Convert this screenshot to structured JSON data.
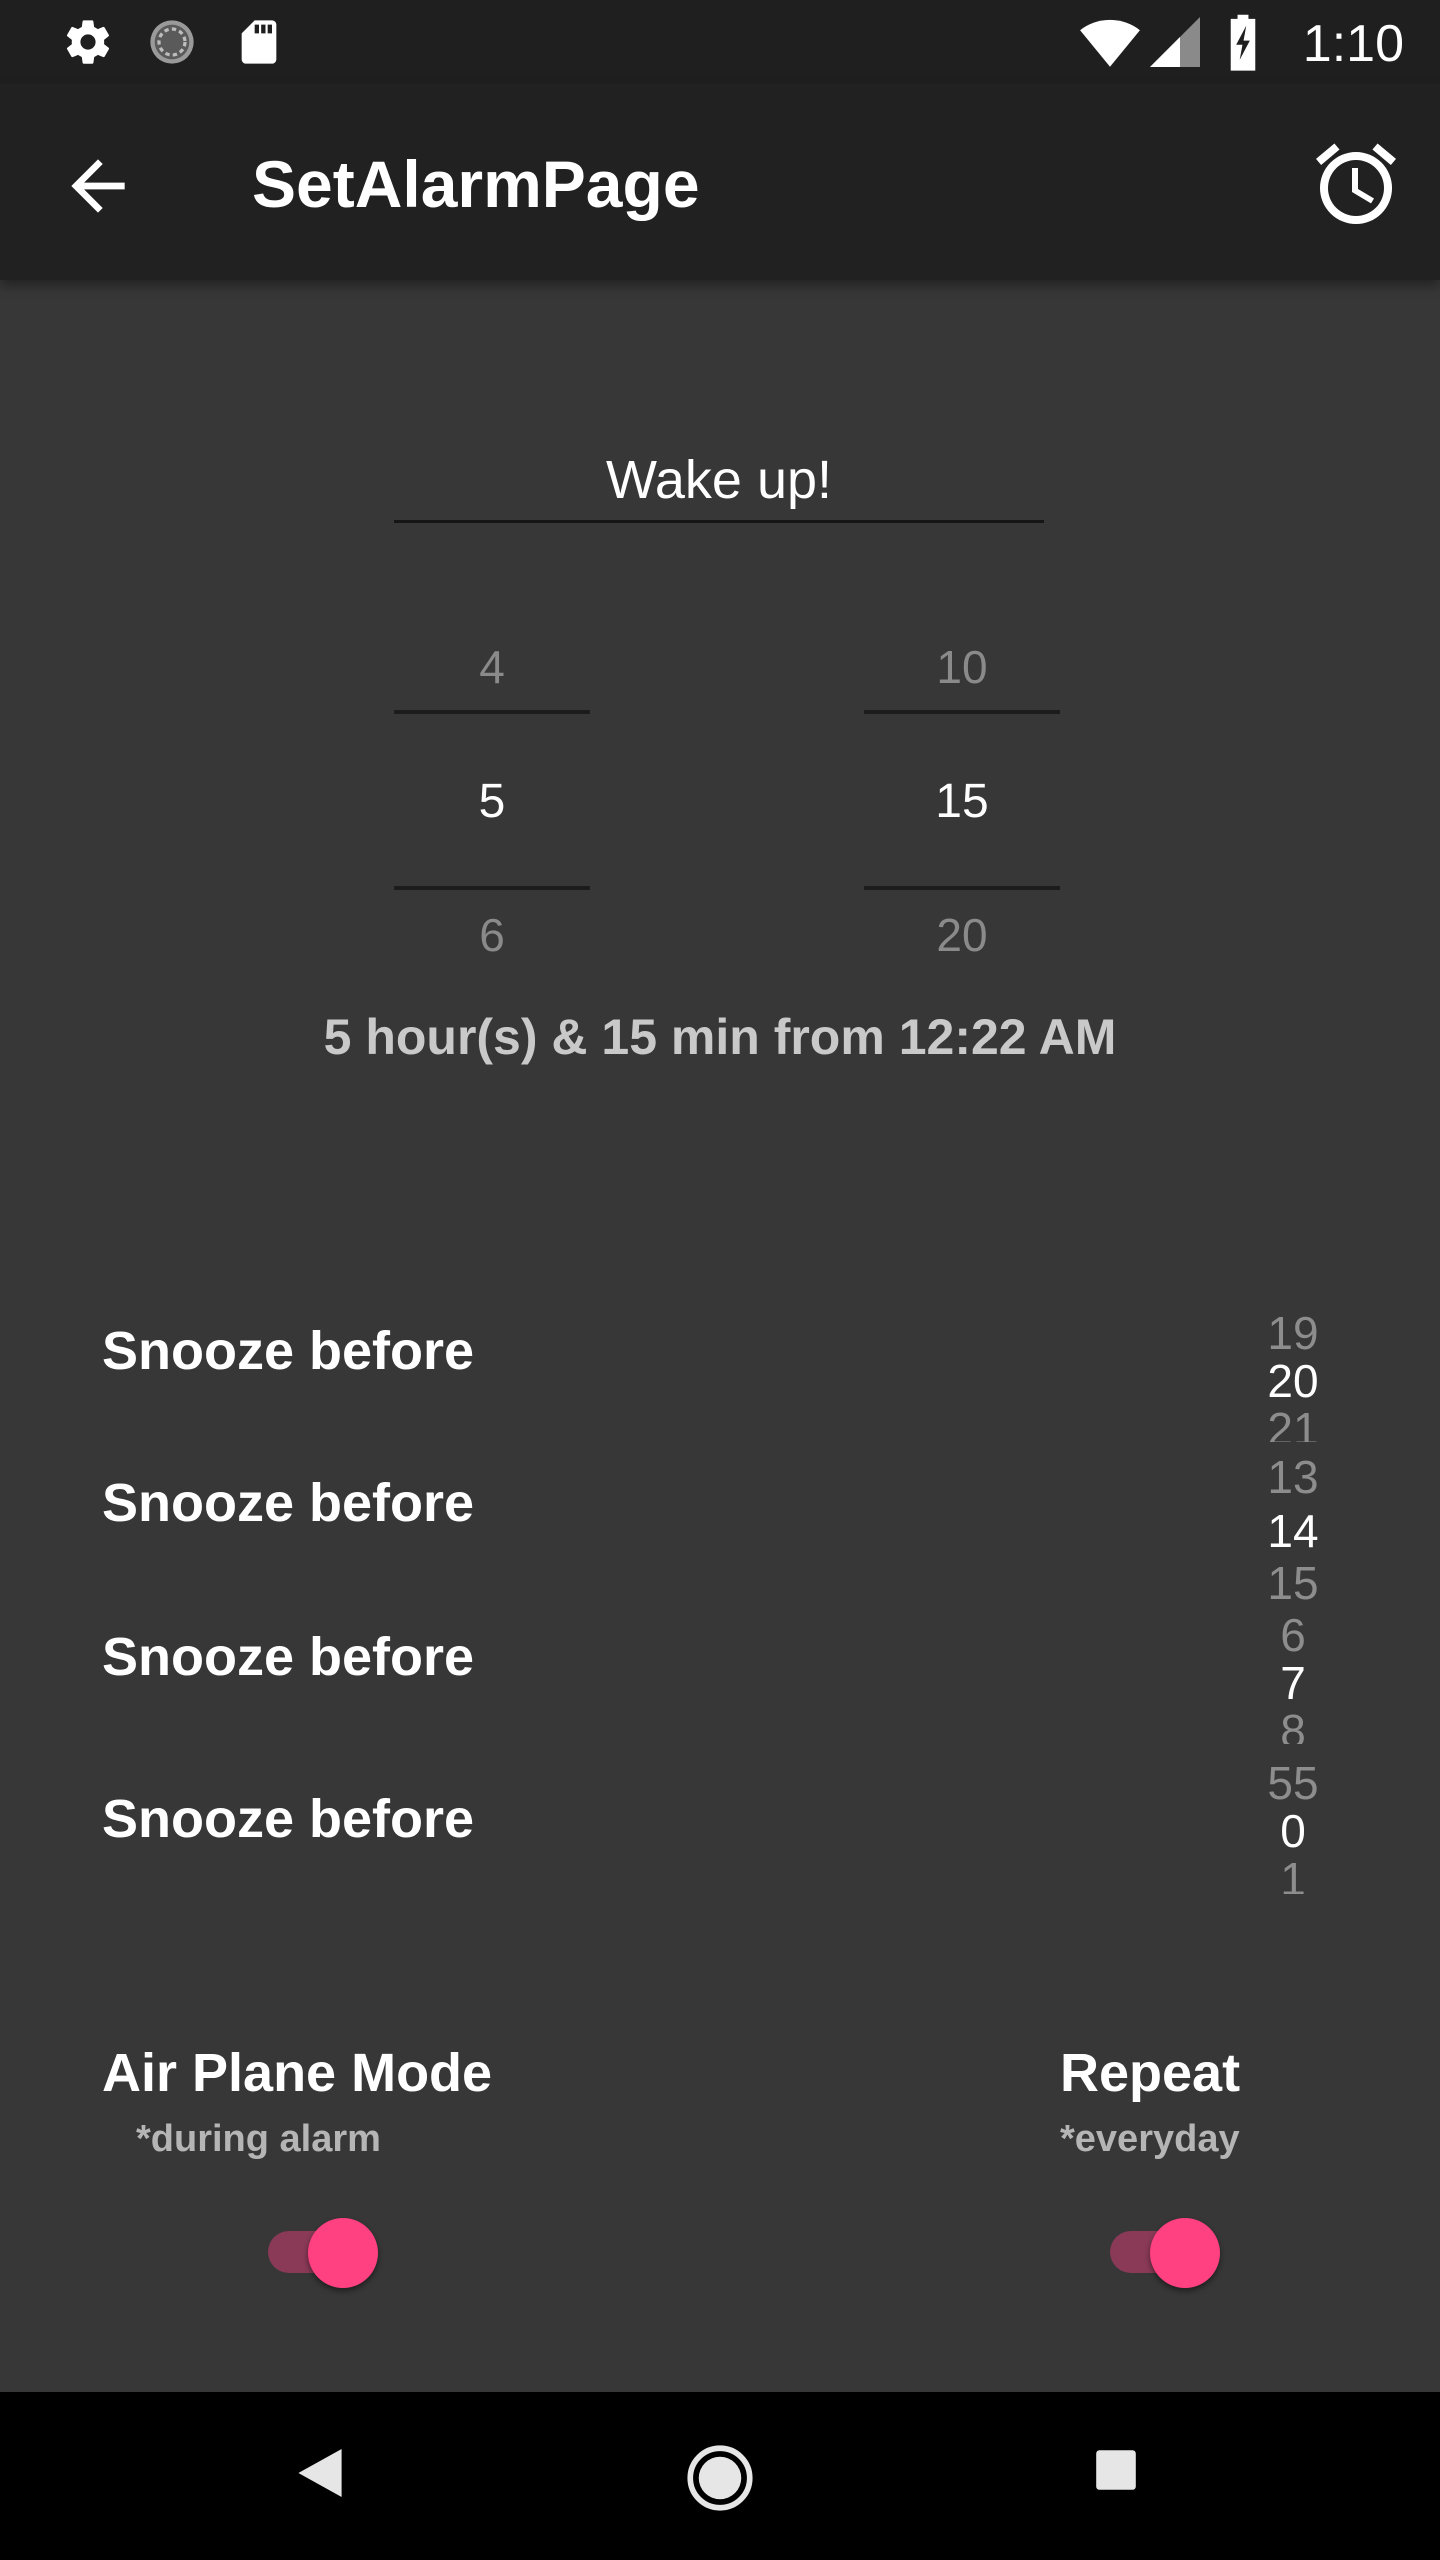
{
  "status_bar": {
    "time": "1:10",
    "left_icons": [
      "gear-icon",
      "loading-icon",
      "sd-card-icon"
    ],
    "right_icons": [
      "wifi-icon",
      "signal-icon",
      "battery-charging-icon"
    ]
  },
  "app_bar": {
    "title": "SetAlarmPage",
    "back_icon": "arrow-left-icon",
    "action_icon": "alarm-clock-icon"
  },
  "label_input": {
    "value": "Wake up!"
  },
  "hour_picker": {
    "prev": "4",
    "selected": "5",
    "next": "6"
  },
  "minute_picker": {
    "prev": "10",
    "selected": "15",
    "next": "20"
  },
  "duration_text": "5 hour(s) & 15 min from 12:22 AM",
  "snooze_rows": [
    {
      "label": "Snooze before",
      "prev": "19",
      "selected": "20",
      "next": "21"
    },
    {
      "label": "Snooze before",
      "prev": "13",
      "selected": "14",
      "next": "15"
    },
    {
      "label": "Snooze before",
      "prev": "6",
      "selected": "7",
      "next": "8"
    },
    {
      "label": "Snooze before",
      "prev": "55",
      "selected": "0",
      "next": "1"
    }
  ],
  "airplane": {
    "title": "Air Plane Mode",
    "subtitle": "*during alarm",
    "enabled": true
  },
  "repeat": {
    "title": "Repeat",
    "subtitle": "*everyday",
    "enabled": true
  },
  "colors": {
    "accent": "#ff4081",
    "background": "#373737",
    "app_bar": "#212121",
    "status_bar": "#1f1f1f",
    "nav_bar": "#000000"
  },
  "nav_bar": {
    "icons": [
      "back-triangle-icon",
      "home-circle-icon",
      "recents-square-icon"
    ]
  }
}
